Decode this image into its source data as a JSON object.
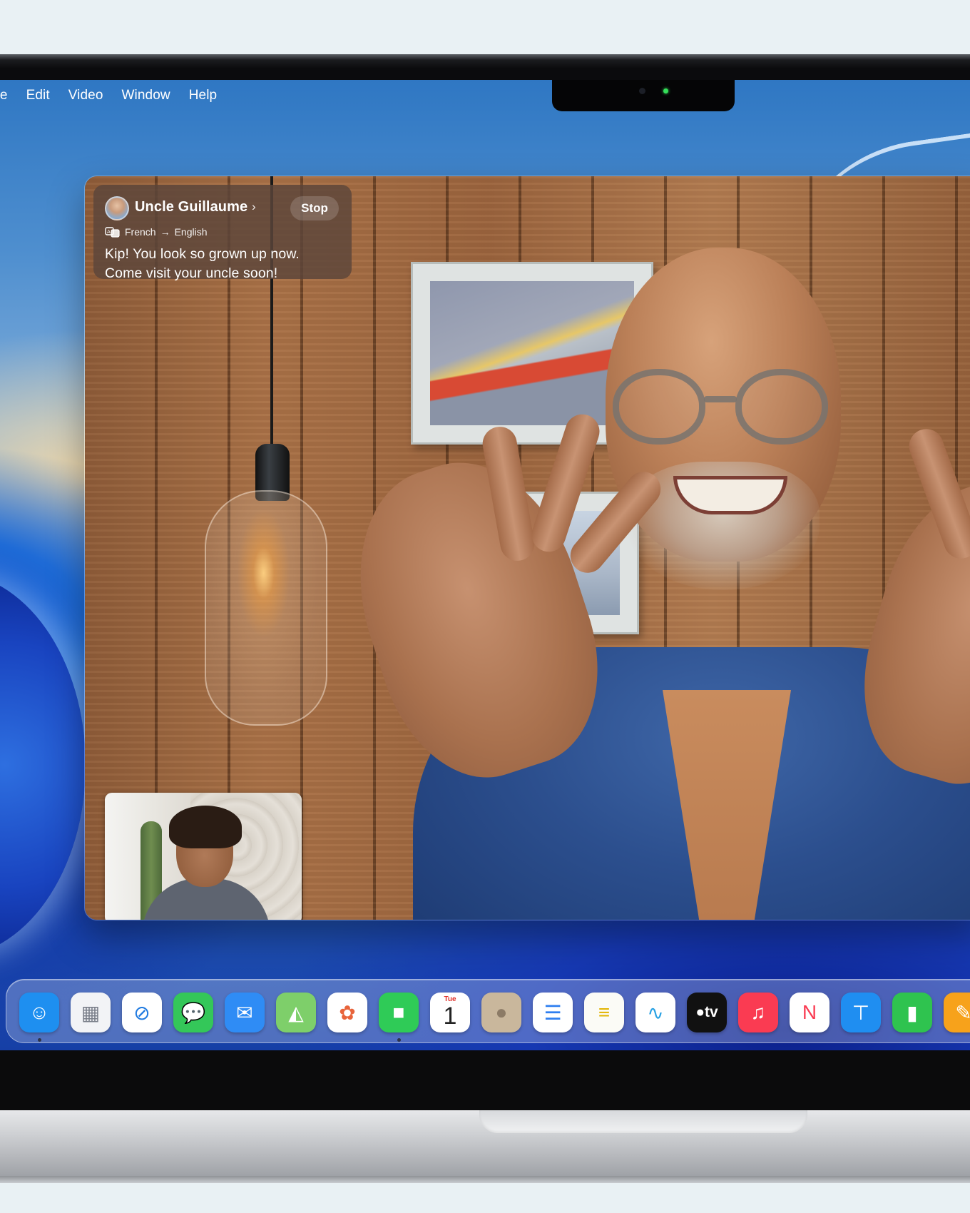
{
  "menubar": {
    "items": [
      "me",
      "Edit",
      "Video",
      "Window",
      "Help"
    ]
  },
  "caption": {
    "name": "Uncle Guillaume",
    "chevron": "›",
    "stop_label": "Stop",
    "source_language": "French",
    "arrow": "→",
    "target_language": "English",
    "line_1": "Kip! You look so grown up now.",
    "line_2": "Come visit your uncle soon!",
    "translate_icon": "translate-icon"
  },
  "dock": {
    "apps": [
      {
        "name": "Finder",
        "icon": "finder-icon",
        "color": "#1e8ff0",
        "running": true
      },
      {
        "name": "Launchpad",
        "icon": "launchpad-icon",
        "color": "#f2f3f6",
        "running": false
      },
      {
        "name": "Safari",
        "icon": "safari-icon",
        "color": "#ffffff",
        "running": false
      },
      {
        "name": "Messages",
        "icon": "messages-icon",
        "color": "#34c759",
        "running": false
      },
      {
        "name": "Mail",
        "icon": "mail-icon",
        "color": "#2f8cf5",
        "running": false
      },
      {
        "name": "Maps",
        "icon": "maps-icon",
        "color": "#7ecf6a",
        "running": false
      },
      {
        "name": "Photos",
        "icon": "photos-icon",
        "color": "#ffffff",
        "running": false
      },
      {
        "name": "FaceTime",
        "icon": "facetime-icon",
        "color": "#2fcb57",
        "running": true
      },
      {
        "name": "Calendar",
        "icon": "calendar-icon",
        "color": "#ffffff",
        "running": false,
        "day": "Tue",
        "date": "1"
      },
      {
        "name": "Contacts",
        "icon": "contacts-icon",
        "color": "#c9b79c",
        "running": false
      },
      {
        "name": "Reminders",
        "icon": "reminders-icon",
        "color": "#ffffff",
        "running": false
      },
      {
        "name": "Notes",
        "icon": "notes-icon",
        "color": "#fbfbf6",
        "running": false
      },
      {
        "name": "Freeform",
        "icon": "freeform-icon",
        "color": "#ffffff",
        "running": false
      },
      {
        "name": "TV",
        "icon": "tv-icon",
        "color": "#111111",
        "running": false,
        "label": "tv"
      },
      {
        "name": "Music",
        "icon": "music-icon",
        "color": "#fa3b52",
        "running": false
      },
      {
        "name": "News",
        "icon": "news-icon",
        "color": "#ffffff",
        "running": false
      },
      {
        "name": "Keynote",
        "icon": "keynote-icon",
        "color": "#1f8ef1",
        "running": false
      },
      {
        "name": "Numbers",
        "icon": "numbers-icon",
        "color": "#2fc34f",
        "running": false
      },
      {
        "name": "Pages",
        "icon": "pages-icon",
        "color": "#f7a21b",
        "running": false
      }
    ]
  },
  "colors": {
    "caption_bg": "#5c463a",
    "camera_led": "#35e05a"
  }
}
